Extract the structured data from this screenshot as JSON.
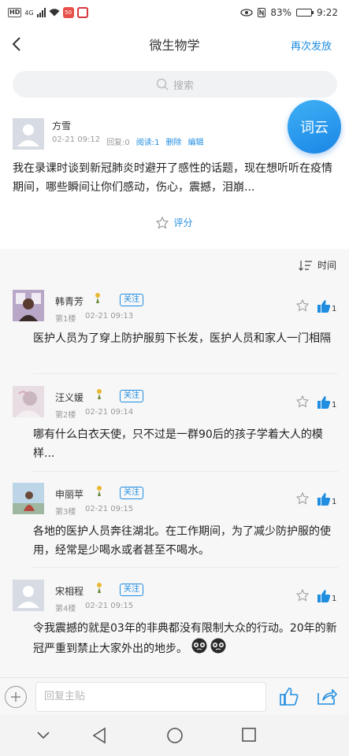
{
  "status_bar": {
    "hd": "HD",
    "network": "4G",
    "app_badge": "50",
    "battery": "83%",
    "battery_level": 0.83,
    "time": "9:22"
  },
  "nav": {
    "title": "微生物学",
    "action": "再次发放"
  },
  "search": {
    "placeholder": "搜索"
  },
  "post": {
    "author": "方雪",
    "time": "02-21 09:12",
    "replies": "回复:0",
    "reads": "阅读:1",
    "delete": "删除",
    "edit": "编辑",
    "body": "我在录课时谈到新冠肺炎时避开了感性的话题，现在想听听在疫情期间，哪些瞬间让你们感动，伤心，震撼，泪崩...",
    "rate": "评分"
  },
  "wordcloud": "词云",
  "sort": {
    "label": "时间"
  },
  "replies": [
    {
      "name": "韩青芳",
      "follow": "关注",
      "floor": "第1楼",
      "time": "02-21 09:13",
      "likes": "1",
      "body": "医护人员为了穿上防护服剪下长发，医护人员和家人一门相隔"
    },
    {
      "name": "汪义媛",
      "follow": "关注",
      "floor": "第2楼",
      "time": "02-21 09:14",
      "likes": "1",
      "body": "哪有什么白衣天使，只不过是一群90后的孩子学着大人的模样..."
    },
    {
      "name": "申丽苹",
      "follow": "关注",
      "floor": "第3楼",
      "time": "02-21 09:15",
      "likes": "1",
      "body": "各地的医护人员奔往湖北。在工作期间，为了减少防护服的使用，经常是少喝水或者甚至不喝水。"
    },
    {
      "name": "宋相程",
      "follow": "关注",
      "floor": "第4楼",
      "time": "02-21 09:15",
      "likes": "1",
      "body": "令我震撼的就是03年的非典都没有限制大众的行动。20年的新冠严重到禁止大家外出的地步。"
    }
  ],
  "input": {
    "placeholder": "回复主贴"
  },
  "colors": {
    "accent": "#1f8de0",
    "background": "#f7f7f8"
  }
}
